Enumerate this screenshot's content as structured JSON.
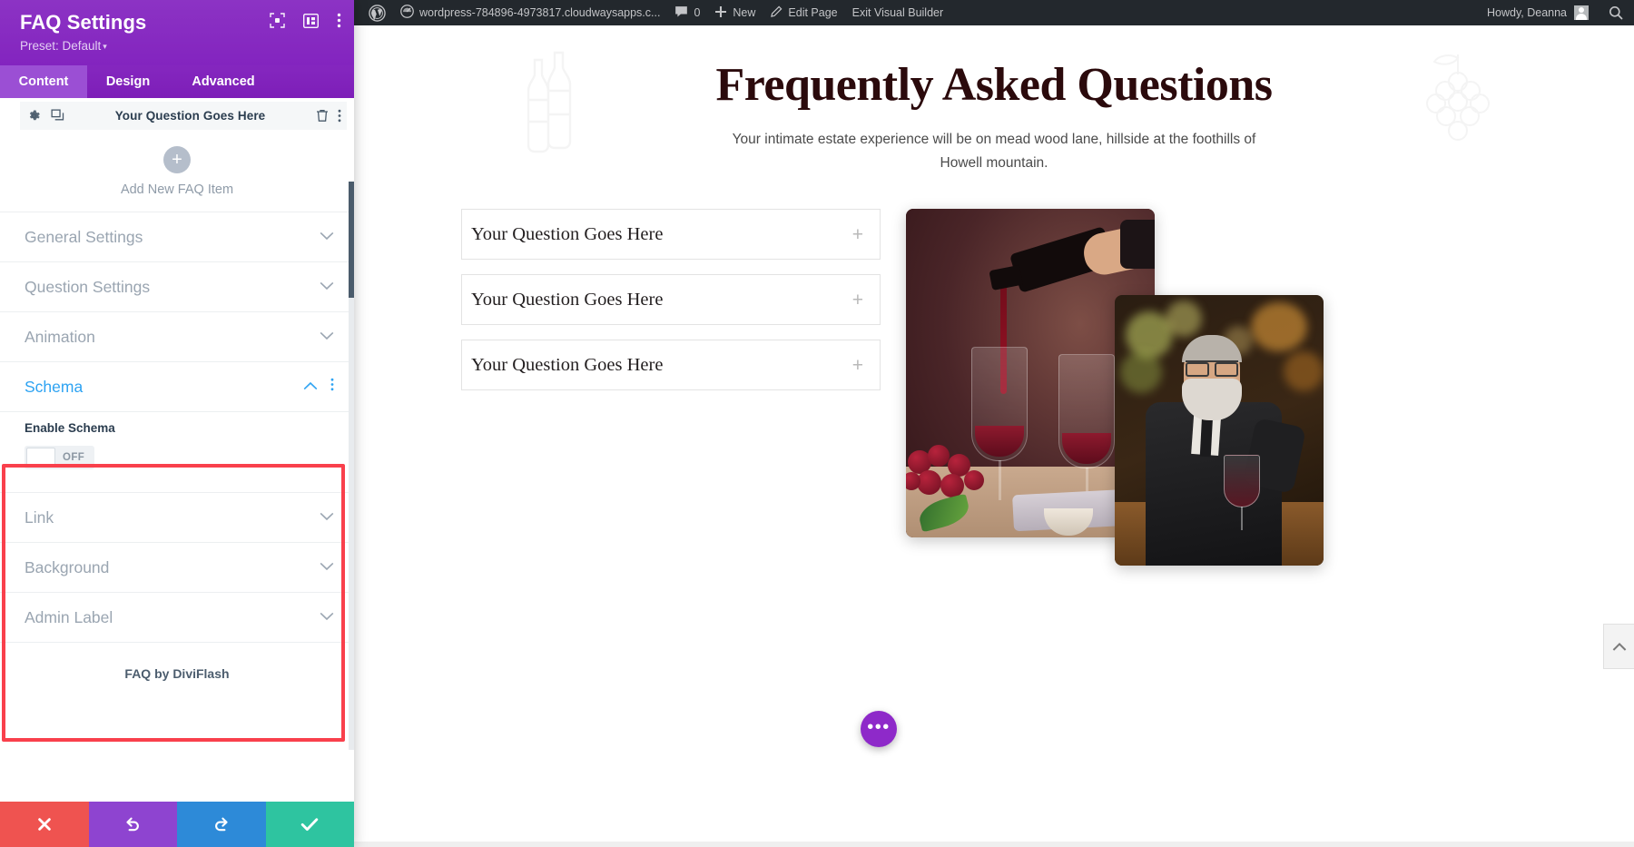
{
  "panel": {
    "title": "FAQ Settings",
    "preset": "Preset: Default",
    "preset_caret": "▾",
    "tabs": [
      {
        "label": "Content",
        "active": true
      },
      {
        "label": "Design",
        "active": false
      },
      {
        "label": "Advanced",
        "active": false
      }
    ],
    "head_icons": [
      "target-icon",
      "layout-columns-icon",
      "kebab-menu-icon"
    ],
    "faq_item": {
      "label": "Your Question Goes Here",
      "gear_icon": "gear-icon",
      "duplicate_icon": "duplicate-icon",
      "trash_icon": "trash-icon",
      "kebab_icon": "kebab-menu-icon"
    },
    "add_new": {
      "plus": "+",
      "label": "Add New FAQ Item"
    },
    "sections": [
      {
        "label": "General Settings",
        "open": false
      },
      {
        "label": "Question Settings",
        "open": false
      },
      {
        "label": "Animation",
        "open": false
      }
    ],
    "schema": {
      "label": "Schema",
      "open": true,
      "field_label": "Enable Schema",
      "toggle_state": "OFF",
      "kebab_icon": "kebab-menu-icon"
    },
    "sections_after": [
      {
        "label": "Link",
        "open": false
      },
      {
        "label": "Background",
        "open": false
      },
      {
        "label": "Admin Label",
        "open": false
      }
    ],
    "byline": "FAQ by DiviFlash",
    "footer": [
      {
        "name": "cancel-button",
        "icon": "x-icon",
        "color": "#ef5350"
      },
      {
        "name": "undo-button",
        "icon": "undo-arrow-icon",
        "color": "#8e44d0"
      },
      {
        "name": "redo-button",
        "icon": "redo-arrow-icon",
        "color": "#2d8ad8"
      },
      {
        "name": "save-button",
        "icon": "checkmark-icon",
        "color": "#2ec4a0"
      }
    ],
    "highlight_color": "#f9404c"
  },
  "adminbar": {
    "wp_logo": "wordpress-logo-icon",
    "site_name": "wordpress-784896-4973817.cloudwaysapps.c...",
    "site_icon": "dashboard-icon",
    "comments_icon": "comment-bubble-icon",
    "comments_count": "0",
    "new_icon": "plus-icon",
    "new_label": "New",
    "edit_icon": "pencil-icon",
    "edit_label": "Edit Page",
    "exit_label": "Exit Visual Builder",
    "howdy": "Howdy, Deanna",
    "avatar": "user-avatar",
    "search_icon": "search-icon"
  },
  "page": {
    "heading": "Frequently Asked Questions",
    "subheading": "Your intimate estate experience will be on mead wood lane, hillside at the foothills of Howell mountain.",
    "deco_left": "wine-bottles-watermark-icon",
    "deco_right": "grapes-watermark-icon",
    "faqs": [
      {
        "question": "Your Question Goes Here",
        "toggle": "+"
      },
      {
        "question": "Your Question Goes Here",
        "toggle": "+"
      },
      {
        "question": "Your Question Goes Here",
        "toggle": "+"
      }
    ],
    "images": [
      {
        "name": "wine-pouring-photo",
        "alt": "Red wine being poured into glasses with grapes"
      },
      {
        "name": "man-drinking-wine-photo",
        "alt": "Bearded man in suit drinking wine at a bar"
      }
    ],
    "floating_button": {
      "name": "divi-menu-button",
      "label": "•••",
      "color": "#8e29c9"
    },
    "scroll_top": {
      "name": "scroll-to-top-button",
      "icon": "chevron-up-icon"
    }
  }
}
